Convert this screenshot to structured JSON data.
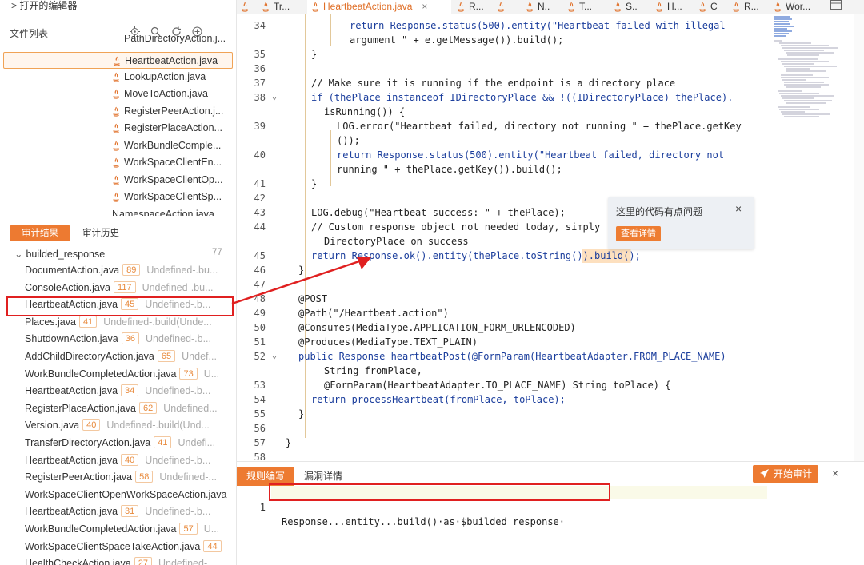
{
  "left": {
    "open_editors": "> 打开的编辑器",
    "files_title": "文件列表",
    "partial_top": "PathDirectoryAction.j...",
    "files": [
      "HeartbeatAction.java",
      "LookupAction.java",
      "MoveToAction.java",
      "RegisterPeerAction.j...",
      "RegisterPlaceAction...",
      "WorkBundleComple...",
      "WorkSpaceClientEn...",
      "WorkSpaceClientOp...",
      "WorkSpaceClientSp..."
    ],
    "partial_bottom": "NamespaceAction.java",
    "tab_results": "审计结果",
    "tab_history": "审计历史",
    "tree_root": "builded_response",
    "tree_count": "77",
    "results": [
      {
        "name": "DocumentAction.java",
        "line": "89",
        "desc": "Undefined-.bu..."
      },
      {
        "name": "ConsoleAction.java",
        "line": "117",
        "desc": "Undefined-.bu..."
      },
      {
        "name": "HeartbeatAction.java",
        "line": "45",
        "desc": "Undefined-.b..."
      },
      {
        "name": "Places.java",
        "line": "41",
        "desc": "Undefined-.build(Unde..."
      },
      {
        "name": "ShutdownAction.java",
        "line": "36",
        "desc": "Undefined-.b..."
      },
      {
        "name": "AddChildDirectoryAction.java",
        "line": "65",
        "desc": "Undef..."
      },
      {
        "name": "WorkBundleCompletedAction.java",
        "line": "73",
        "desc": "U..."
      },
      {
        "name": "HeartbeatAction.java",
        "line": "34",
        "desc": "Undefined-.b..."
      },
      {
        "name": "RegisterPlaceAction.java",
        "line": "62",
        "desc": "Undefined..."
      },
      {
        "name": "Version.java",
        "line": "40",
        "desc": "Undefined-.build(Und..."
      },
      {
        "name": "TransferDirectoryAction.java",
        "line": "41",
        "desc": "Undefi..."
      },
      {
        "name": "HeartbeatAction.java",
        "line": "40",
        "desc": "Undefined-.b..."
      },
      {
        "name": "RegisterPeerAction.java",
        "line": "58",
        "desc": "Undefined-..."
      },
      {
        "name": "WorkSpaceClientOpenWorkSpaceAction.java",
        "line": "",
        "desc": ""
      },
      {
        "name": "HeartbeatAction.java",
        "line": "31",
        "desc": "Undefined-.b..."
      },
      {
        "name": "WorkBundleCompletedAction.java",
        "line": "57",
        "desc": "U..."
      },
      {
        "name": "WorkSpaceClientSpaceTakeAction.java",
        "line": "44",
        "desc": ""
      },
      {
        "name": "HealthCheckAction.java",
        "line": "27",
        "desc": "Undefined-..."
      }
    ]
  },
  "tabs": {
    "items": [
      "Tr...",
      "HeartbeatAction.java",
      "R...",
      "",
      "N..",
      "T...",
      "S..",
      "H...",
      "C",
      "R...",
      "Wor..."
    ],
    "close": "×"
  },
  "popup": {
    "title": "这里的代码有点问题",
    "close": "×",
    "button": "查看详情"
  },
  "bottom": {
    "tab_rule": "规则编写",
    "tab_vuln": "漏洞详情",
    "start": "开始审计",
    "close": "×",
    "query_line": "1",
    "query": "Response...entity...build()·as·$builded_response·"
  },
  "code_lines": [
    {
      "n": "34",
      "t": "return Response.status(500).entity(\"Heartbeat failed with illegal"
    },
    {
      "n": "",
      "t": "argument \" + e.getMessage()).build();"
    },
    {
      "n": "35",
      "t": "}"
    },
    {
      "n": "36",
      "t": ""
    },
    {
      "n": "37",
      "t": "// Make sure it is running if the endpoint is a directory place"
    },
    {
      "n": "38",
      "t": "if (thePlace instanceof IDirectoryPlace && !((IDirectoryPlace) thePlace)."
    },
    {
      "n": "",
      "t": "isRunning()) {"
    },
    {
      "n": "39",
      "t": "LOG.error(\"Heartbeat failed, directory not running \" + thePlace.getKey"
    },
    {
      "n": "",
      "t": "());"
    },
    {
      "n": "40",
      "t": "return Response.status(500).entity(\"Heartbeat failed, directory not"
    },
    {
      "n": "",
      "t": "running \" + thePlace.getKey()).build();"
    },
    {
      "n": "41",
      "t": "}"
    },
    {
      "n": "42",
      "t": ""
    },
    {
      "n": "43",
      "t": "LOG.debug(\"Heartbeat success: \" + thePlace);"
    },
    {
      "n": "44",
      "t": "// Custom response object not needed today, simply ... the"
    },
    {
      "n": "",
      "t": "DirectoryPlace on success"
    },
    {
      "n": "45",
      "t": "return Response.ok().entity(thePlace.toString()).build();"
    },
    {
      "n": "46",
      "t": "}"
    },
    {
      "n": "47",
      "t": ""
    },
    {
      "n": "48",
      "t": "@POST"
    },
    {
      "n": "49",
      "t": "@Path(\"/Heartbeat.action\")"
    },
    {
      "n": "50",
      "t": "@Consumes(MediaType.APPLICATION_FORM_URLENCODED)"
    },
    {
      "n": "51",
      "t": "@Produces(MediaType.TEXT_PLAIN)"
    },
    {
      "n": "52",
      "t": "public Response heartbeatPost(@FormParam(HeartbeatAdapter.FROM_PLACE_NAME)"
    },
    {
      "n": "",
      "t": "String fromPlace,"
    },
    {
      "n": "53",
      "t": "@FormParam(HeartbeatAdapter.TO_PLACE_NAME) String toPlace) {"
    },
    {
      "n": "54",
      "t": "return processHeartbeat(fromPlace, toPlace);"
    },
    {
      "n": "55",
      "t": "}"
    },
    {
      "n": "56",
      "t": ""
    },
    {
      "n": "57",
      "t": "}"
    },
    {
      "n": "58",
      "t": ""
    }
  ],
  "colors": {
    "accent": "#ed7a31",
    "highlight_box": "#e02020"
  }
}
